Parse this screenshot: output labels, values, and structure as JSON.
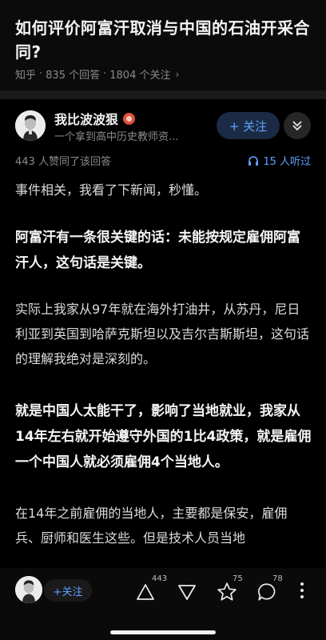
{
  "question": {
    "title": "如何评价阿富汗取消与中国的石油开采合同?",
    "source": "知乎",
    "answer_count": "835 个回答",
    "follower_count": "1804 个关注"
  },
  "author": {
    "name": "我比波波狠",
    "bio": "一个拿到高中历史教师资...",
    "follow_label": "+ 关注"
  },
  "answer": {
    "approval": "443 人赞同了该回答",
    "listen": "15 人听过",
    "paragraphs": [
      {
        "text": "事件相关，我看了下新闻，秒懂。",
        "bold": false
      },
      {
        "text": "阿富汗有一条很关键的话：未能按规定雇佣阿富汗人，这句话是关键。",
        "bold": true
      },
      {
        "text": "实际上我家从97年就在海外打油井，从苏丹，尼日利亚到英国到哈萨克斯坦以及吉尔吉斯斯坦，这句话的理解我绝对是深刻的。",
        "bold": false
      },
      {
        "text": "就是中国人太能干了，影响了当地就业，我家从14年左右就开始遵守外国的1比4政策，就是雇佣一个中国人就必须雇佣4个当地人。",
        "bold": true
      },
      {
        "text": "在14年之前雇佣的当地人，主要都是保安，雇佣兵、厨师和医生这些。但是技术人员当地",
        "bold": false
      }
    ]
  },
  "bottom_bar": {
    "follow_label": "+关注",
    "upvote_count": "443",
    "comment_like_count": "75",
    "comment_count": "78"
  },
  "colors": {
    "accent": "#5ea1ff",
    "background": "#000000"
  }
}
